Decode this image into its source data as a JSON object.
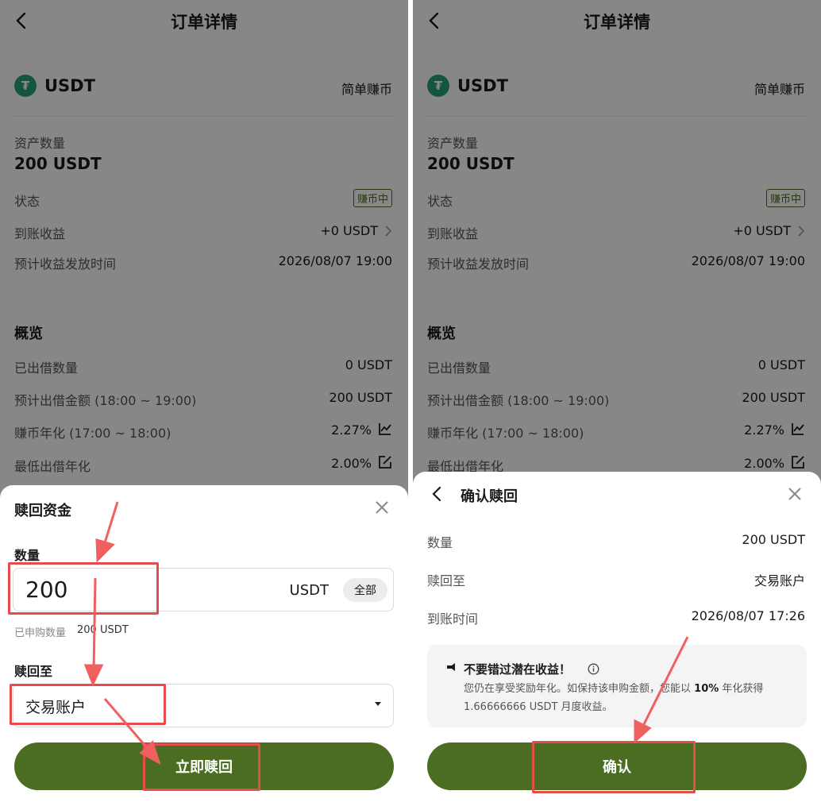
{
  "left": {
    "page": {
      "title": "订单详情",
      "coin": "USDT",
      "coin_symbol": "₮",
      "product": "简单赚币",
      "asset_label": "资产数量",
      "asset_value": "200 USDT",
      "status_label": "状态",
      "status_badge": "赚币中",
      "earnings_label": "到账收益",
      "earnings_value": "+0 USDT",
      "payout_label": "预计收益发放时间",
      "payout_value": "2026/08/07 19:00",
      "overview_title": "概览",
      "lent_label": "已出借数量",
      "lent_value": "0 USDT",
      "est_lend_label": "预计出借金额 (18:00 ~ 19:00)",
      "est_lend_value": "200 USDT",
      "apy_label": "赚币年化 (17:00 ~ 18:00)",
      "apy_value": "2.27%",
      "min_rate_label": "最低出借年化",
      "min_rate_value": "2.00%"
    },
    "sheet": {
      "title": "赎回资金",
      "amount_label": "数量",
      "amount_value": "200",
      "unit": "USDT",
      "all_button": "全部",
      "subscribed_label": "已申购数量",
      "subscribed_value": "200 USDT",
      "redeem_to_label": "赎回至",
      "redeem_to_value": "交易账户",
      "submit_button": "立即赎回"
    }
  },
  "right": {
    "page": {
      "title": "订单详情",
      "coin": "USDT",
      "coin_symbol": "₮",
      "product": "简单赚币",
      "asset_label": "资产数量",
      "asset_value": "200 USDT",
      "status_label": "状态",
      "status_badge": "赚币中",
      "earnings_label": "到账收益",
      "earnings_value": "+0 USDT",
      "payout_label": "预计收益发放时间",
      "payout_value": "2026/08/07 19:00",
      "overview_title": "概览",
      "lent_label": "已出借数量",
      "lent_value": "0 USDT",
      "est_lend_label": "预计出借金额 (18:00 ~ 19:00)",
      "est_lend_value": "200 USDT",
      "apy_label": "赚币年化 (17:00 ~ 18:00)",
      "apy_value": "2.27%",
      "min_rate_label": "最低出借年化",
      "min_rate_value": "2.00%"
    },
    "sheet": {
      "title": "确认赎回",
      "qty_label": "数量",
      "qty_value": "200 USDT",
      "redeem_to_label": "赎回至",
      "redeem_to_value": "交易账户",
      "arrival_label": "到账时间",
      "arrival_value": "2026/08/07 17:26",
      "notice_title": "不要错过潜在收益！",
      "notice_line1_a": "您仍在享受奖励年化。如保持该申购金额，您能以",
      "notice_rate": "10%",
      "notice_line1_b": "年化获得",
      "notice_line2": "1.66666666 USDT 月度收益。",
      "confirm_button": "确认"
    }
  },
  "colors": {
    "accent_green": "#4a6d22",
    "highlight_red": "#e74c4c",
    "tether_green": "#26a17b"
  },
  "icons": [
    "back-arrow-icon",
    "tether-logo-icon",
    "chevron-right-icon",
    "trend-chart-icon",
    "edit-icon",
    "close-icon",
    "info-icon",
    "bell-icon",
    "dropdown-caret-icon"
  ]
}
